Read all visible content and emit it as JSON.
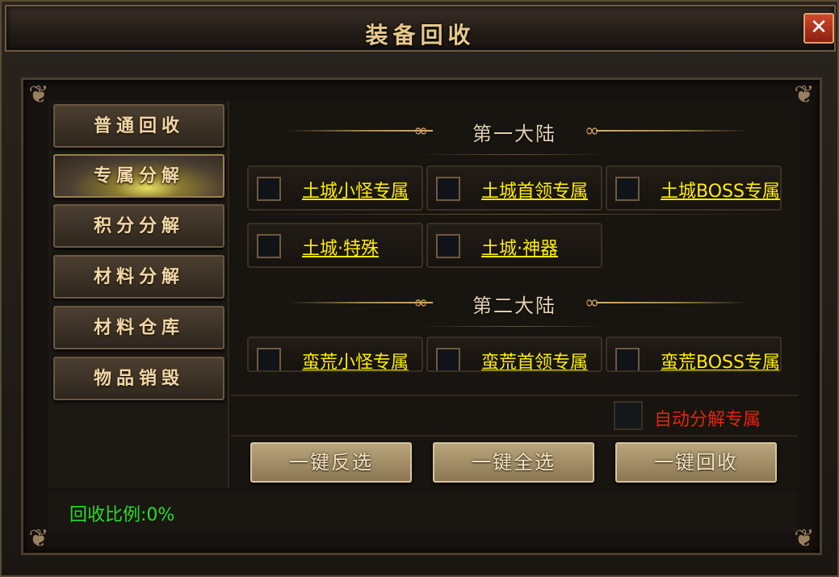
{
  "window": {
    "title": "装备回收",
    "close_label": "✕"
  },
  "sidebar": {
    "items": [
      {
        "label": "普通回收",
        "active": false
      },
      {
        "label": "专属分解",
        "active": true
      },
      {
        "label": "积分分解",
        "active": false
      },
      {
        "label": "材料分解",
        "active": false
      },
      {
        "label": "材料仓库",
        "active": false
      },
      {
        "label": "物品销毁",
        "active": false
      }
    ]
  },
  "sections": [
    {
      "title": "第一大陆",
      "options": [
        {
          "label": "土城小怪专属",
          "checked": false
        },
        {
          "label": "土城首领专属",
          "checked": false
        },
        {
          "label": "土城BOSS专属",
          "checked": false
        },
        {
          "label": "土城·特殊",
          "checked": false
        },
        {
          "label": "土城·神器",
          "checked": false
        }
      ]
    },
    {
      "title": "第二大陆",
      "options": [
        {
          "label": "蛮荒小怪专属",
          "checked": false
        },
        {
          "label": "蛮荒首领专属",
          "checked": false
        },
        {
          "label": "蛮荒BOSS专属",
          "checked": false
        }
      ]
    }
  ],
  "auto_decompose": {
    "label": "自动分解专属",
    "checked": false
  },
  "actions": {
    "invert_label": "一键反选",
    "select_all_label": "一键全选",
    "recycle_label": "一键回收"
  },
  "footer": {
    "ratio_text": "回收比例:0%"
  },
  "colors": {
    "option_text": "#ffee00",
    "auto_text": "#e52410",
    "ratio_text": "#22e022",
    "title_text": "#e8c98a"
  }
}
